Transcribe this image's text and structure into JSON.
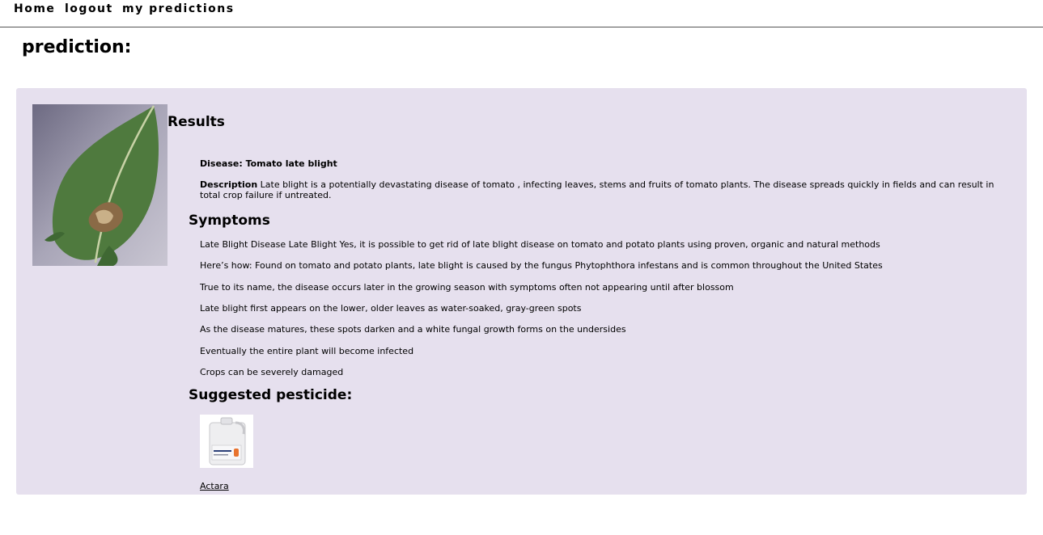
{
  "nav": {
    "home": "Home",
    "logout": "logout",
    "my_predictions": "my predictions"
  },
  "page_title": "prediction:",
  "results": {
    "heading": "Results",
    "disease": "Disease: Tomato late blight",
    "description_label": "Description",
    "description_text": " Late blight is a potentially devastating disease of tomato , infecting leaves, stems and fruits of tomato plants. The disease spreads quickly in fields and can result in total crop failure if untreated."
  },
  "symptoms": {
    "heading": "Symptoms",
    "items": [
      "Late Blight Disease Late Blight Yes, it is possible to get rid of late blight disease on tomato and potato plants using proven, organic and natural methods",
      "Here’s how: Found on tomato and potato plants, late blight is caused by the fungus Phytophthora infestans and is common throughout the United States",
      "True to its name, the disease occurs later in the growing season with symptoms often not appearing until after blossom",
      "Late blight first appears on the lower, older leaves as water-soaked, gray-green spots",
      "As the disease matures, these spots darken and a white fungal growth forms on the undersides",
      "Eventually the entire plant will become infected",
      "Crops can be severely damaged"
    ]
  },
  "pesticide": {
    "heading": "Suggested pesticide:",
    "name": "Actara"
  },
  "colors": {
    "card_background": "#e6e0ee",
    "nav_border": "#555555"
  }
}
